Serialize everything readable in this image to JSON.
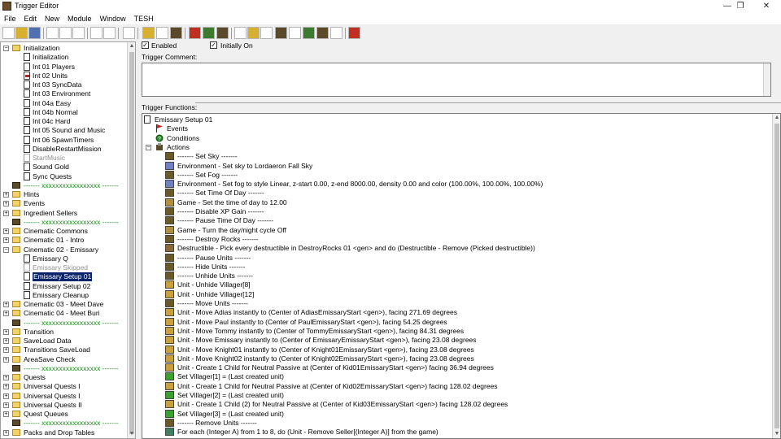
{
  "window": {
    "title": "Trigger Editor",
    "minimize_glyph": "—",
    "restore_glyph": "❐",
    "close_glyph": "✕"
  },
  "menu": [
    "File",
    "Edit",
    "New",
    "Module",
    "Window",
    "TESH"
  ],
  "toolbar": {
    "icons": [
      "new-map-icon",
      "open-icon",
      "save-icon",
      "cut-icon",
      "copy-icon",
      "paste-icon",
      "undo-icon",
      "redo-icon",
      "delete-icon",
      "new-category-icon",
      "new-trigger-icon",
      "new-comment-icon",
      "new-event-icon",
      "new-condition-icon",
      "new-action-icon",
      "terrain-editor-icon",
      "unit-editor-icon",
      "sound-editor-icon",
      "object-editor-icon",
      "campaign-editor-icon",
      "ai-editor-icon",
      "object-manager-icon",
      "import-manager-icon",
      "test-map-icon"
    ]
  },
  "tree": {
    "rows": [
      {
        "label": "Initialization",
        "indent": 0,
        "type": "folder",
        "expander": "−"
      },
      {
        "label": "Initialization",
        "indent": 1,
        "type": "trigger"
      },
      {
        "label": "Int 01 Players",
        "indent": 1,
        "type": "trigger"
      },
      {
        "label": "Int 02 Units",
        "indent": 1,
        "type": "trigger-disabled"
      },
      {
        "label": "Int 03 SyncData",
        "indent": 1,
        "type": "trigger"
      },
      {
        "label": "Int 03 Environment",
        "indent": 1,
        "type": "trigger"
      },
      {
        "label": "Int 04a Easy",
        "indent": 1,
        "type": "trigger"
      },
      {
        "label": "Int 04b Normal",
        "indent": 1,
        "type": "trigger"
      },
      {
        "label": "Int 04c Hard",
        "indent": 1,
        "type": "trigger"
      },
      {
        "label": "Int 05 Sound and Music",
        "indent": 1,
        "type": "trigger"
      },
      {
        "label": "Int 06 SpawnTimers",
        "indent": 1,
        "type": "trigger"
      },
      {
        "label": "DisableRestartMission",
        "indent": 1,
        "type": "trigger"
      },
      {
        "label": "StartMusic",
        "indent": 1,
        "type": "trigger-gray"
      },
      {
        "label": "Sound Gold",
        "indent": 1,
        "type": "trigger"
      },
      {
        "label": "Sync Quests",
        "indent": 1,
        "type": "trigger"
      },
      {
        "label": "------- xxxxxxxxxxxxxxxxx -------",
        "indent": 0,
        "type": "comment"
      },
      {
        "label": "Hints",
        "indent": 0,
        "type": "folder",
        "expander": "+"
      },
      {
        "label": "Events",
        "indent": 0,
        "type": "folder",
        "expander": "+"
      },
      {
        "label": "Ingredient Sellers",
        "indent": 0,
        "type": "folder",
        "expander": "+"
      },
      {
        "label": "------- xxxxxxxxxxxxxxxxx -------",
        "indent": 0,
        "type": "comment"
      },
      {
        "label": "Cinematic Commons",
        "indent": 0,
        "type": "folder",
        "expander": "+"
      },
      {
        "label": "Cinematic 01 - Intro",
        "indent": 0,
        "type": "folder",
        "expander": "+"
      },
      {
        "label": "Cinematic 02 - Emissary",
        "indent": 0,
        "type": "folder",
        "expander": "−"
      },
      {
        "label": "Emissary Q",
        "indent": 1,
        "type": "trigger"
      },
      {
        "label": "Emissary Skipped",
        "indent": 1,
        "type": "trigger-gray"
      },
      {
        "label": "Emissary Setup 01",
        "indent": 1,
        "type": "trigger",
        "selected": true
      },
      {
        "label": "Emissary Setup 02",
        "indent": 1,
        "type": "trigger"
      },
      {
        "label": "Emissary Cleanup",
        "indent": 1,
        "type": "trigger"
      },
      {
        "label": "Cinematic 03 - Meet Dave",
        "indent": 0,
        "type": "folder",
        "expander": "+"
      },
      {
        "label": "Cinematic 04 - Meet Buri",
        "indent": 0,
        "type": "folder",
        "expander": "+"
      },
      {
        "label": "------- xxxxxxxxxxxxxxxxx -------",
        "indent": 0,
        "type": "comment"
      },
      {
        "label": "Transition",
        "indent": 0,
        "type": "folder",
        "expander": "+"
      },
      {
        "label": "SaveLoad Data",
        "indent": 0,
        "type": "folder",
        "expander": "+"
      },
      {
        "label": "Transitions SaveLoad",
        "indent": 0,
        "type": "folder",
        "expander": "+"
      },
      {
        "label": "AreaSave Check",
        "indent": 0,
        "type": "folder",
        "expander": "+"
      },
      {
        "label": "------- xxxxxxxxxxxxxxxxx -------",
        "indent": 0,
        "type": "comment"
      },
      {
        "label": "Quests",
        "indent": 0,
        "type": "folder",
        "expander": "+"
      },
      {
        "label": "Universal Quests I",
        "indent": 0,
        "type": "folder",
        "expander": "+"
      },
      {
        "label": "Universal Quests I",
        "indent": 0,
        "type": "folder",
        "expander": "+"
      },
      {
        "label": "Universal Quests II",
        "indent": 0,
        "type": "folder",
        "expander": "+"
      },
      {
        "label": "Quest Queues",
        "indent": 0,
        "type": "folder",
        "expander": "+"
      },
      {
        "label": "------- xxxxxxxxxxxxxxxxx -------",
        "indent": 0,
        "type": "comment"
      },
      {
        "label": "Packs and Drop Tables",
        "indent": 0,
        "type": "folder",
        "expander": "+"
      }
    ]
  },
  "trigger": {
    "enabled_label": "Enabled",
    "enabled_checked": true,
    "initially_on_label": "Initially On",
    "initially_on_checked": true,
    "comment_label": "Trigger Comment:",
    "comment_value": "",
    "functions_label": "Trigger Functions:",
    "name": "Emissary Setup 01",
    "events_label": "Events",
    "conditions_label": "Conditions",
    "actions_label": "Actions",
    "actions": [
      {
        "icon": "cmt",
        "text": "------- Set Sky -------"
      },
      {
        "icon": "env",
        "text": "Environment - Set sky to Lordaeron Fall Sky"
      },
      {
        "icon": "cmt",
        "text": "------- Set Fog -------"
      },
      {
        "icon": "env",
        "text": "Environment - Set fog to style Linear, z-start 0.00, z-end 8000.00, density 0.00 and color (100.00%, 100.00%, 100.00%)"
      },
      {
        "icon": "cmt",
        "text": "------- Set Time Of Day -------"
      },
      {
        "icon": "game",
        "text": "Game - Set the time of day to 12.00"
      },
      {
        "icon": "cmt",
        "text": "------- Disable XP Gain -------"
      },
      {
        "icon": "cmt",
        "text": "------- Pause Time Of Day -------"
      },
      {
        "icon": "game",
        "text": "Game - Turn the day/night cycle Off"
      },
      {
        "icon": "cmt",
        "text": "------- Destroy Rocks -------"
      },
      {
        "icon": "dest",
        "text": "Destructible - Pick every destructible in DestroyRocks 01 <gen> and do (Destructible - Remove (Picked destructible))"
      },
      {
        "icon": "cmt",
        "text": "------- Pause Units -------"
      },
      {
        "icon": "cmt",
        "text": "------- Hide Units -------"
      },
      {
        "icon": "cmt",
        "text": "------- Unhide Units -------"
      },
      {
        "icon": "unit",
        "text": "Unit - Unhide Villager[8]"
      },
      {
        "icon": "unit",
        "text": "Unit - Unhide Villager[12]"
      },
      {
        "icon": "cmt",
        "text": "------- Move Units -------"
      },
      {
        "icon": "unit",
        "text": "Unit - Move Adias instantly to (Center of AdiasEmissaryStart <gen>), facing 271.69 degrees"
      },
      {
        "icon": "unit",
        "text": "Unit - Move Paul instantly to (Center of PaulEmissaryStart <gen>), facing 54.25 degrees"
      },
      {
        "icon": "unit",
        "text": "Unit - Move Tommy instantly to (Center of TommyEmissaryStart <gen>), facing 84.31 degrees"
      },
      {
        "icon": "unit",
        "text": "Unit - Move Emissary instantly to (Center of EmissaryEmissaryStart <gen>), facing 23.08 degrees"
      },
      {
        "icon": "unit",
        "text": "Unit - Move Knight01 instantly to (Center of Knight01EmissaryStart <gen>), facing 23.08 degrees"
      },
      {
        "icon": "unit",
        "text": "Unit - Move Knight02 instantly to (Center of Knight02EmissaryStart <gen>), facing 23.08 degrees"
      },
      {
        "icon": "unit",
        "text": "Unit - Create 1 Child for Neutral Passive at (Center of Kid01EmissaryStart <gen>) facing 36.94 degrees"
      },
      {
        "icon": "set",
        "text": "Set Villager[1] = (Last created unit)"
      },
      {
        "icon": "unit",
        "text": "Unit - Create 1 Child for Neutral Passive at (Center of Kid02EmissaryStart <gen>) facing 128.02 degrees"
      },
      {
        "icon": "set",
        "text": "Set Villager[2] = (Last created unit)"
      },
      {
        "icon": "unit",
        "text": "Unit - Create 1 Child (2) for Neutral Passive at (Center of Kid03EmissaryStart <gen>) facing 128.02 degrees"
      },
      {
        "icon": "set",
        "text": "Set Villager[3] = (Last created unit)"
      },
      {
        "icon": "cmt",
        "text": "------- Remove Units -------"
      },
      {
        "icon": "loop",
        "text": "For each (Integer A) from 1 to 8, do (Unit - Remove Seller[(Integer A)] from the game)"
      }
    ]
  }
}
